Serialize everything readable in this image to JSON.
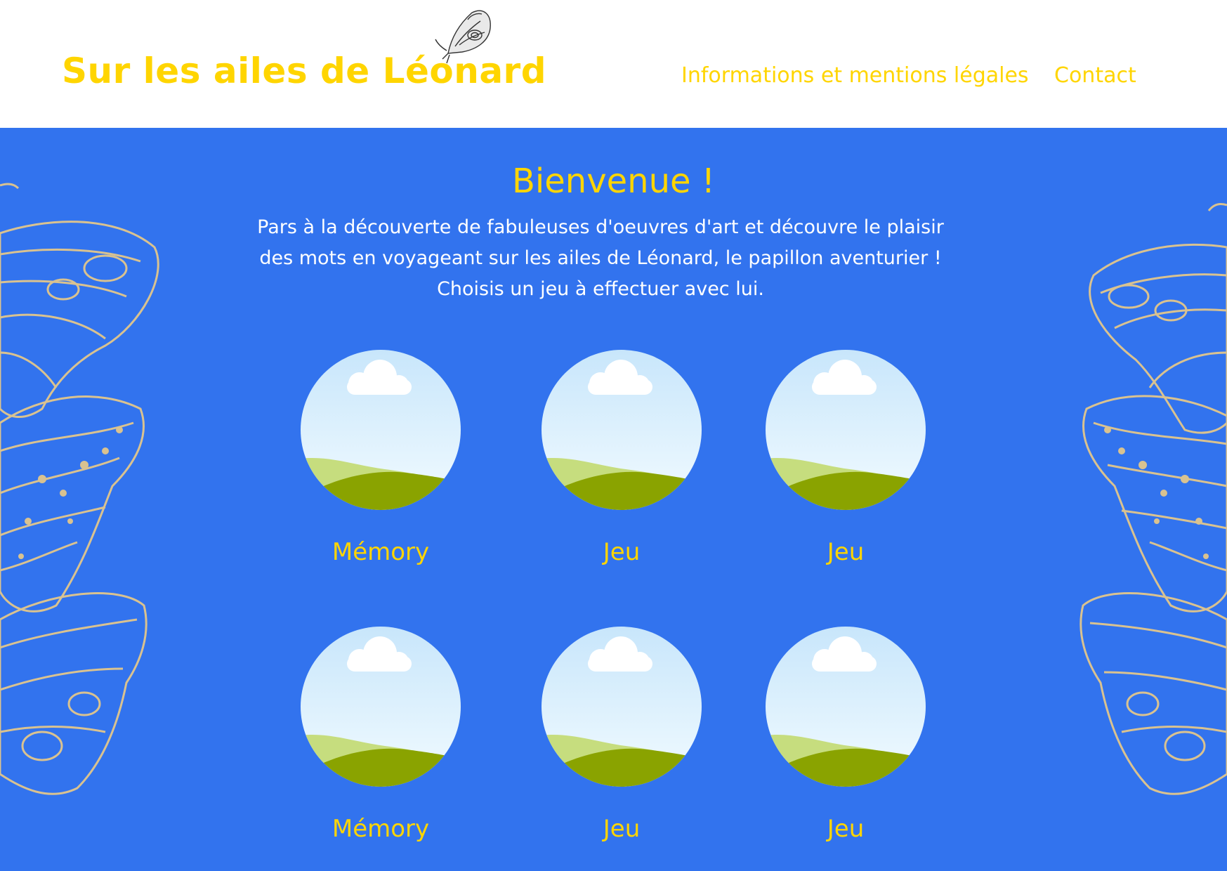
{
  "header": {
    "site_title": "Sur les ailes de Léonard",
    "nav": {
      "info_label": "Informations et mentions légales",
      "contact_label": "Contact"
    }
  },
  "welcome": {
    "title": "Bienvenue !",
    "lines": [
      "Pars à la découverte de fabuleuses d'oeuvres d'art et découvre le plaisir",
      "des mots en voyageant sur les ailes de Léonard, le papillon aventurier  !",
      "Choisis un jeu à effectuer avec lui."
    ]
  },
  "games": [
    {
      "label": "Mémory",
      "icon": "landscape-placeholder-icon"
    },
    {
      "label": "Jeu",
      "icon": "landscape-placeholder-icon"
    },
    {
      "label": "Jeu",
      "icon": "landscape-placeholder-icon"
    },
    {
      "label": "Mémory",
      "icon": "landscape-placeholder-icon"
    },
    {
      "label": "Jeu",
      "icon": "landscape-placeholder-icon"
    },
    {
      "label": "Jeu",
      "icon": "landscape-placeholder-icon"
    }
  ],
  "colors": {
    "accent_yellow": "#FFD500",
    "background_blue": "#3273EE",
    "butterfly_tan": "#D9C290",
    "grass_dark": "#8AA300",
    "grass_light": "#C6DD7E",
    "sky_top": "#C8E6FB",
    "sky_bottom": "#F2FBFF"
  }
}
